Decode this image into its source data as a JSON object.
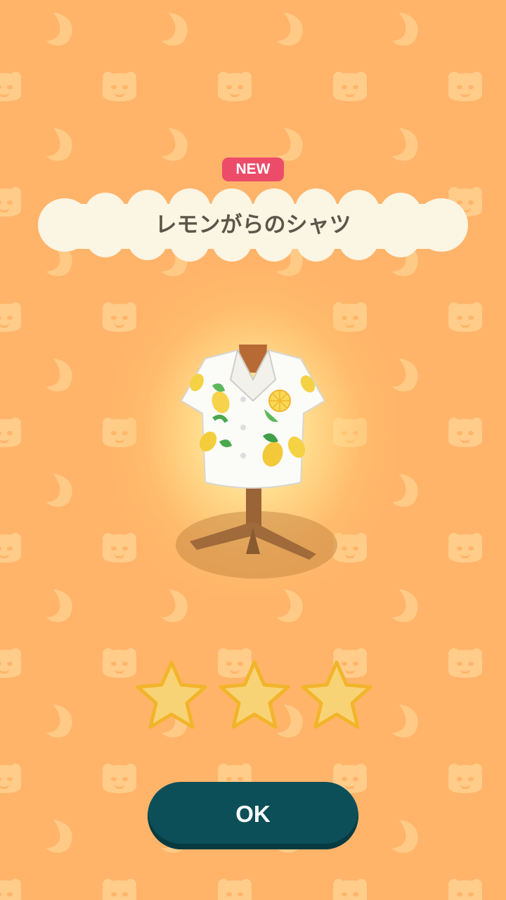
{
  "colors": {
    "background": "#ffb46a",
    "badge": "#ec4c6a",
    "title_panel": "#fbf5e3",
    "title_text": "#5d5549",
    "star_fill": "#f8d376",
    "star_outline": "#f2b42a",
    "ok_button": "#0c4f58"
  },
  "badge": {
    "label": "NEW"
  },
  "item": {
    "name": "レモンがらのシャツ",
    "icon": "lemon-print-shirt-icon"
  },
  "rating": {
    "stars": 3,
    "max": 3,
    "icon": "star-icon"
  },
  "ok_button": {
    "label": "OK"
  }
}
